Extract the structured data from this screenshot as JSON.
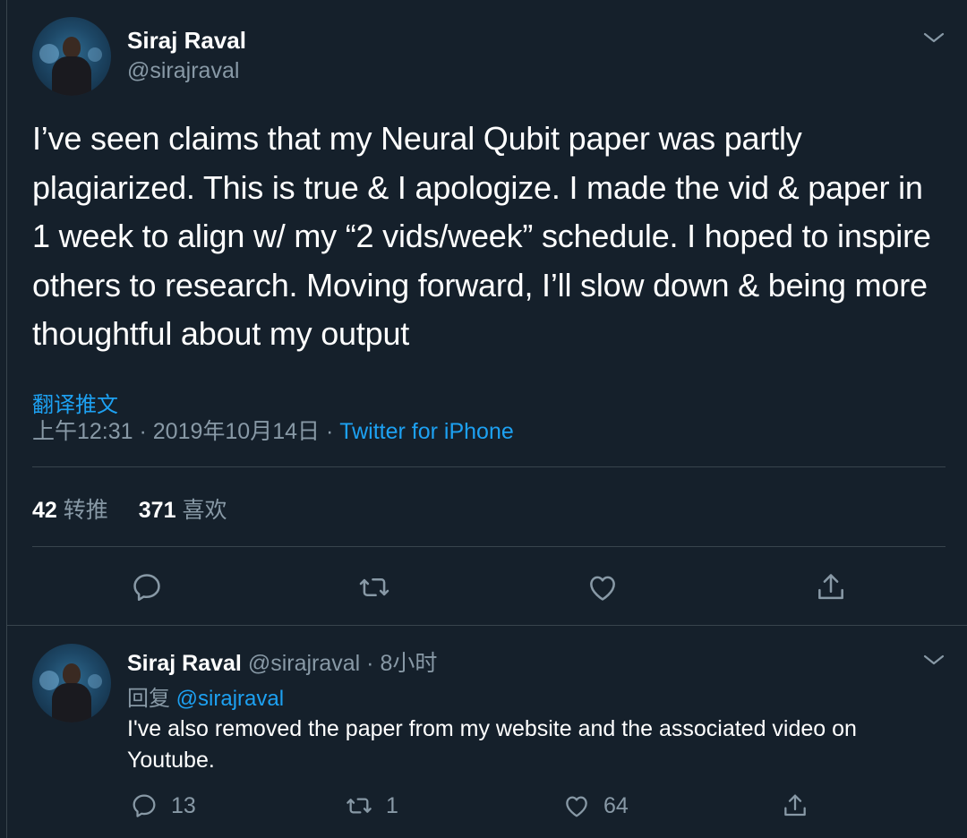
{
  "main": {
    "author_name": "Siraj Raval",
    "author_handle": "@sirajraval",
    "text": "I’ve seen claims that my Neural Qubit paper was partly plagiarized. This is true & I apologize. I made the vid & paper in 1 week to align w/ my “2 vids/week” schedule. I hoped to inspire others to research. Moving forward, I’ll slow down & being more thoughtful about my output",
    "translate_label": "翻译推文",
    "time": "上午12:31",
    "separator": " · ",
    "date": "2019年10月14日",
    "source": "Twitter for iPhone",
    "retweet_count": "42",
    "retweet_label": "转推",
    "like_count": "371",
    "like_label": "喜欢",
    "icons": [
      "reply-icon",
      "retweet-icon",
      "like-icon",
      "share-icon"
    ]
  },
  "reply": {
    "author_name": "Siraj Raval",
    "author_handle": "@sirajraval",
    "separator": " · ",
    "age": "8小时",
    "reply_prefix": "回复 ",
    "reply_to": "@sirajraval",
    "text": "I've also removed the paper from my website and the associated video on Youtube.",
    "reply_count": "13",
    "retweet_count": "1",
    "like_count": "64"
  },
  "colors": {
    "background": "#15202b",
    "text": "#ffffff",
    "secondary": "#8899a6",
    "accent": "#1da1f2",
    "border": "#38444d"
  }
}
